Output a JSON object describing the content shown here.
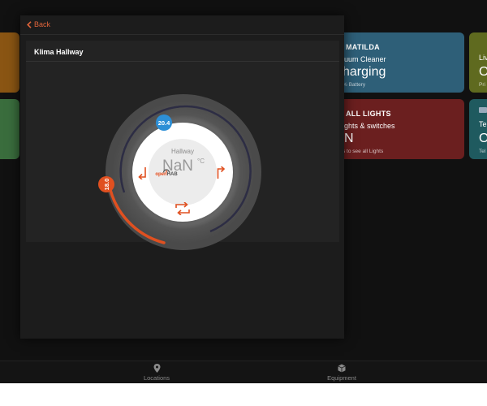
{
  "tiles": {
    "vacuum": {
      "title": "MATILDA",
      "subtitle": "uum Cleaner",
      "state": "harging",
      "note": "% Battery"
    },
    "lights": {
      "title": "ALL LIGHTS",
      "subtitle": "ghts & switches",
      "state": "N",
      "note": "s to see all Lights"
    },
    "right_top": {
      "title": "Liv",
      "state": "O",
      "note": "Pri"
    },
    "right_bottom": {
      "title": "Tel",
      "state": "O",
      "note": "Tel"
    }
  },
  "popup": {
    "back_label": "Back",
    "card_title": "Klima Hallway",
    "thermostat": {
      "room": "Hallway",
      "temperature": "NaN",
      "unit": "°C",
      "current_marker": "20.4",
      "target_marker": "18.0",
      "logo_open": "open",
      "logo_hab": "HAB"
    }
  },
  "nav": {
    "locations_label": "Locations",
    "equipment_label": "Equipment"
  },
  "colors": {
    "accent": "#e05020",
    "current_marker": "#2d8fd6",
    "back_link": "#e0643a"
  }
}
